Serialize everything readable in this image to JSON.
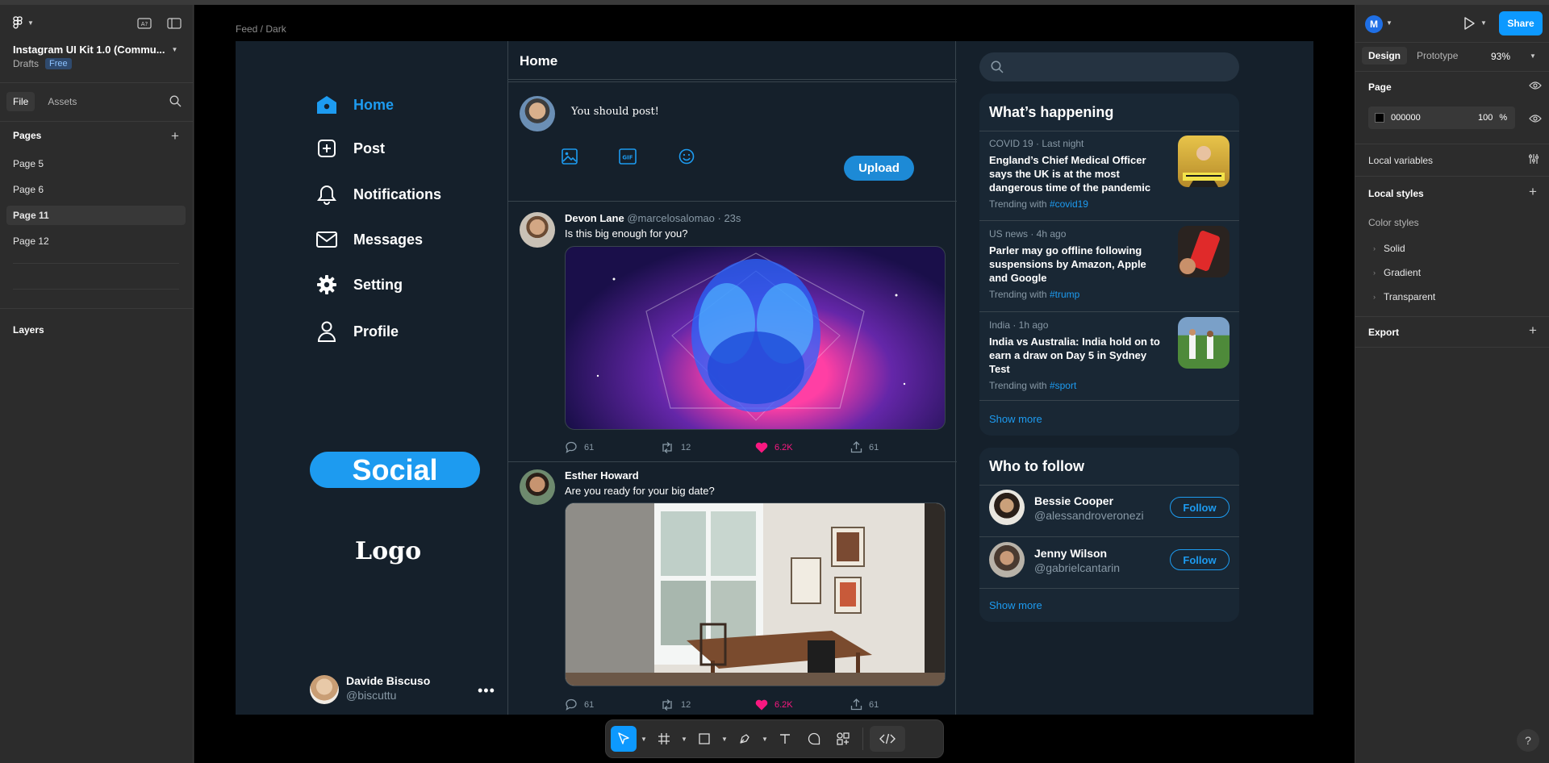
{
  "file": {
    "title": "Instagram UI Kit 1.0 (Commu...",
    "location": "Drafts",
    "plan_badge": "Free"
  },
  "left_panel": {
    "tabs": [
      "File",
      "Assets"
    ],
    "pages_heading": "Pages",
    "pages": [
      "Page 5",
      "Page 6",
      "Page 11",
      "Page 12"
    ],
    "selected_page": "Page 11",
    "layers_heading": "Layers"
  },
  "canvas": {
    "frame_label": "Feed / Dark"
  },
  "app": {
    "nav": [
      {
        "label": "Home",
        "icon": "home-icon"
      },
      {
        "label": "Post",
        "icon": "plus-square-icon"
      },
      {
        "label": "Notifications",
        "icon": "bell-icon"
      },
      {
        "label": "Messages",
        "icon": "mail-icon"
      },
      {
        "label": "Setting",
        "icon": "gear-icon"
      },
      {
        "label": "Profile",
        "icon": "user-icon"
      }
    ],
    "social_button": "Social",
    "logo_text": "Logo",
    "me": {
      "name": "Davide Biscuso",
      "handle": "@biscuttu",
      "more": "•••"
    },
    "feed_title": "Home",
    "compose_placeholder": "You should post!",
    "upload_label": "Upload",
    "tweets": [
      {
        "name": "Devon Lane",
        "handle": "@marcelosalomao",
        "time": "· 23s",
        "text": "Is this big enough for you?",
        "replies": "61",
        "retweets": "12",
        "likes": "6.2K",
        "shares": "61"
      },
      {
        "name": "Esther Howard",
        "handle": "",
        "time": "",
        "text": "Are you ready for your big date?",
        "replies": "61",
        "retweets": "12",
        "likes": "6.2K",
        "shares": "61"
      }
    ],
    "whats_happening": {
      "title": "What’s happening",
      "trends": [
        {
          "meta": "COVID 19 · Last night",
          "title": "England’s Chief Medical Officer says the UK is at the most dangerous time of the pandemic",
          "trending_prefix": "Trending with",
          "tag": "#covid19"
        },
        {
          "meta": "US news · 4h ago",
          "title": "Parler may go offline following suspensions by Amazon, Apple and Google",
          "trending_prefix": "Trending with",
          "tag": "#trump"
        },
        {
          "meta": "India · 1h ago",
          "title": "India vs Australia: India hold on to earn a draw on Day 5 in Sydney Test",
          "trending_prefix": "Trending with",
          "tag": "#sport"
        }
      ],
      "show_more": "Show more"
    },
    "who_to_follow": {
      "title": "Who to follow",
      "people": [
        {
          "name": "Bessie Cooper",
          "handle": "@alessandroveronezi",
          "button": "Follow"
        },
        {
          "name": "Jenny Wilson",
          "handle": "@gabrielcantarin",
          "button": "Follow"
        }
      ],
      "show_more": "Show more"
    }
  },
  "right_panel": {
    "user_initial": "M",
    "share_label": "Share",
    "tabs": [
      "Design",
      "Prototype"
    ],
    "zoom": "93%",
    "page_heading": "Page",
    "page_color": "000000",
    "page_opacity": "100",
    "percent": "%",
    "local_variables": "Local variables",
    "local_styles": "Local styles",
    "color_styles": "Color styles",
    "color_style_groups": [
      "Solid",
      "Gradient",
      "Transparent"
    ],
    "export": "Export",
    "help": "?"
  },
  "colors": {
    "accent": "#1d9bf0",
    "frame_bg": "#15202b",
    "card_bg": "#192734",
    "like": "#f91880",
    "figma_blue": "#0d99ff"
  }
}
